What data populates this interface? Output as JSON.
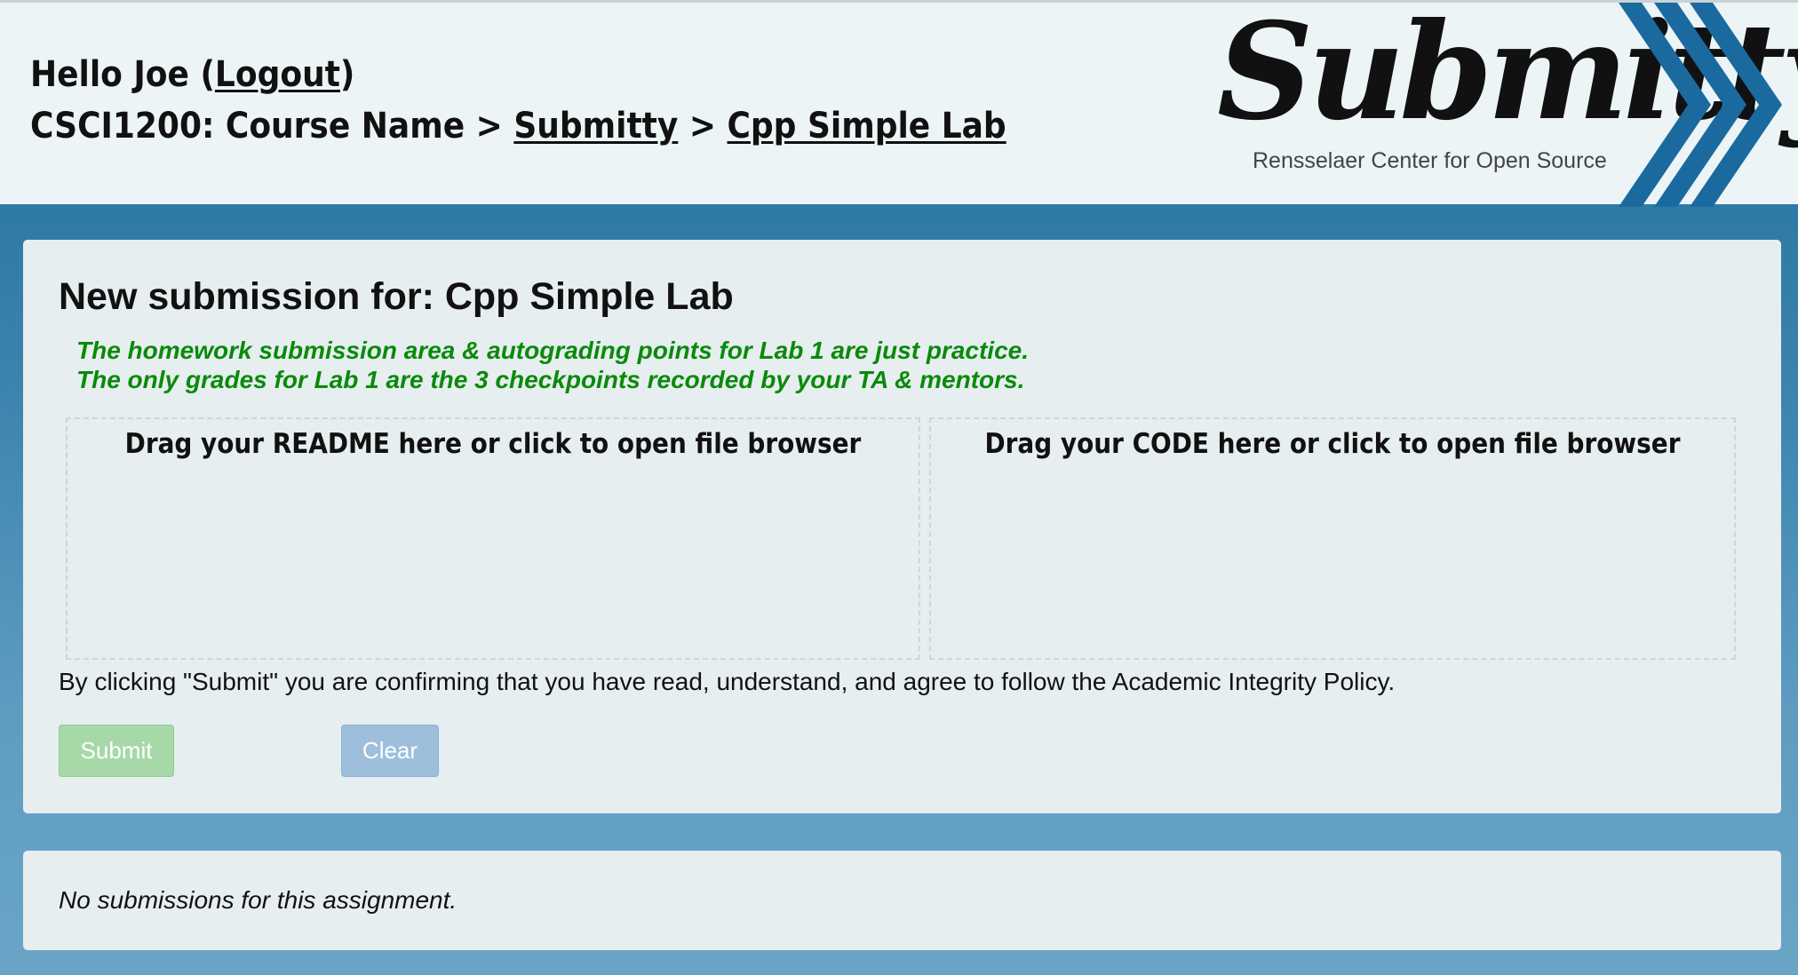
{
  "header": {
    "greeting_prefix": "Hello Joe (",
    "logout_label": "Logout",
    "greeting_suffix": ")",
    "course": "CSCI1200: Course Name",
    "separator": " > ",
    "crumb_submitty": "Submitty",
    "crumb_lab": "Cpp Simple Lab"
  },
  "logo": {
    "wordmark": "Submitty",
    "subtitle": "Rensselaer Center for Open Source",
    "chevron_color": "#1a6aa0"
  },
  "submission": {
    "title": "New submission for: Cpp Simple Lab",
    "notice_line1": "The homework submission area & autograding points for Lab 1 are just practice.",
    "notice_line2": "The only grades for Lab 1 are the 3 checkpoints recorded by your TA & mentors.",
    "dropzone_readme": "Drag your README here or click to open file browser",
    "dropzone_code": "Drag your CODE here or click to open file browser",
    "agreement": "By clicking \"Submit\" you are confirming that you have read, understand, and agree to follow the Academic Integrity Policy.",
    "submit_label": "Submit",
    "clear_label": "Clear"
  },
  "history": {
    "empty_text": "No submissions for this assignment."
  },
  "colors": {
    "header_bg": "#ecf4f6",
    "notice": "#0a8a0a",
    "submit_button": "#a6d8a8",
    "clear_button": "#9dbfdc",
    "page_bg_top": "#1f6e9c",
    "page_bg_bottom": "#6aa5c7"
  }
}
